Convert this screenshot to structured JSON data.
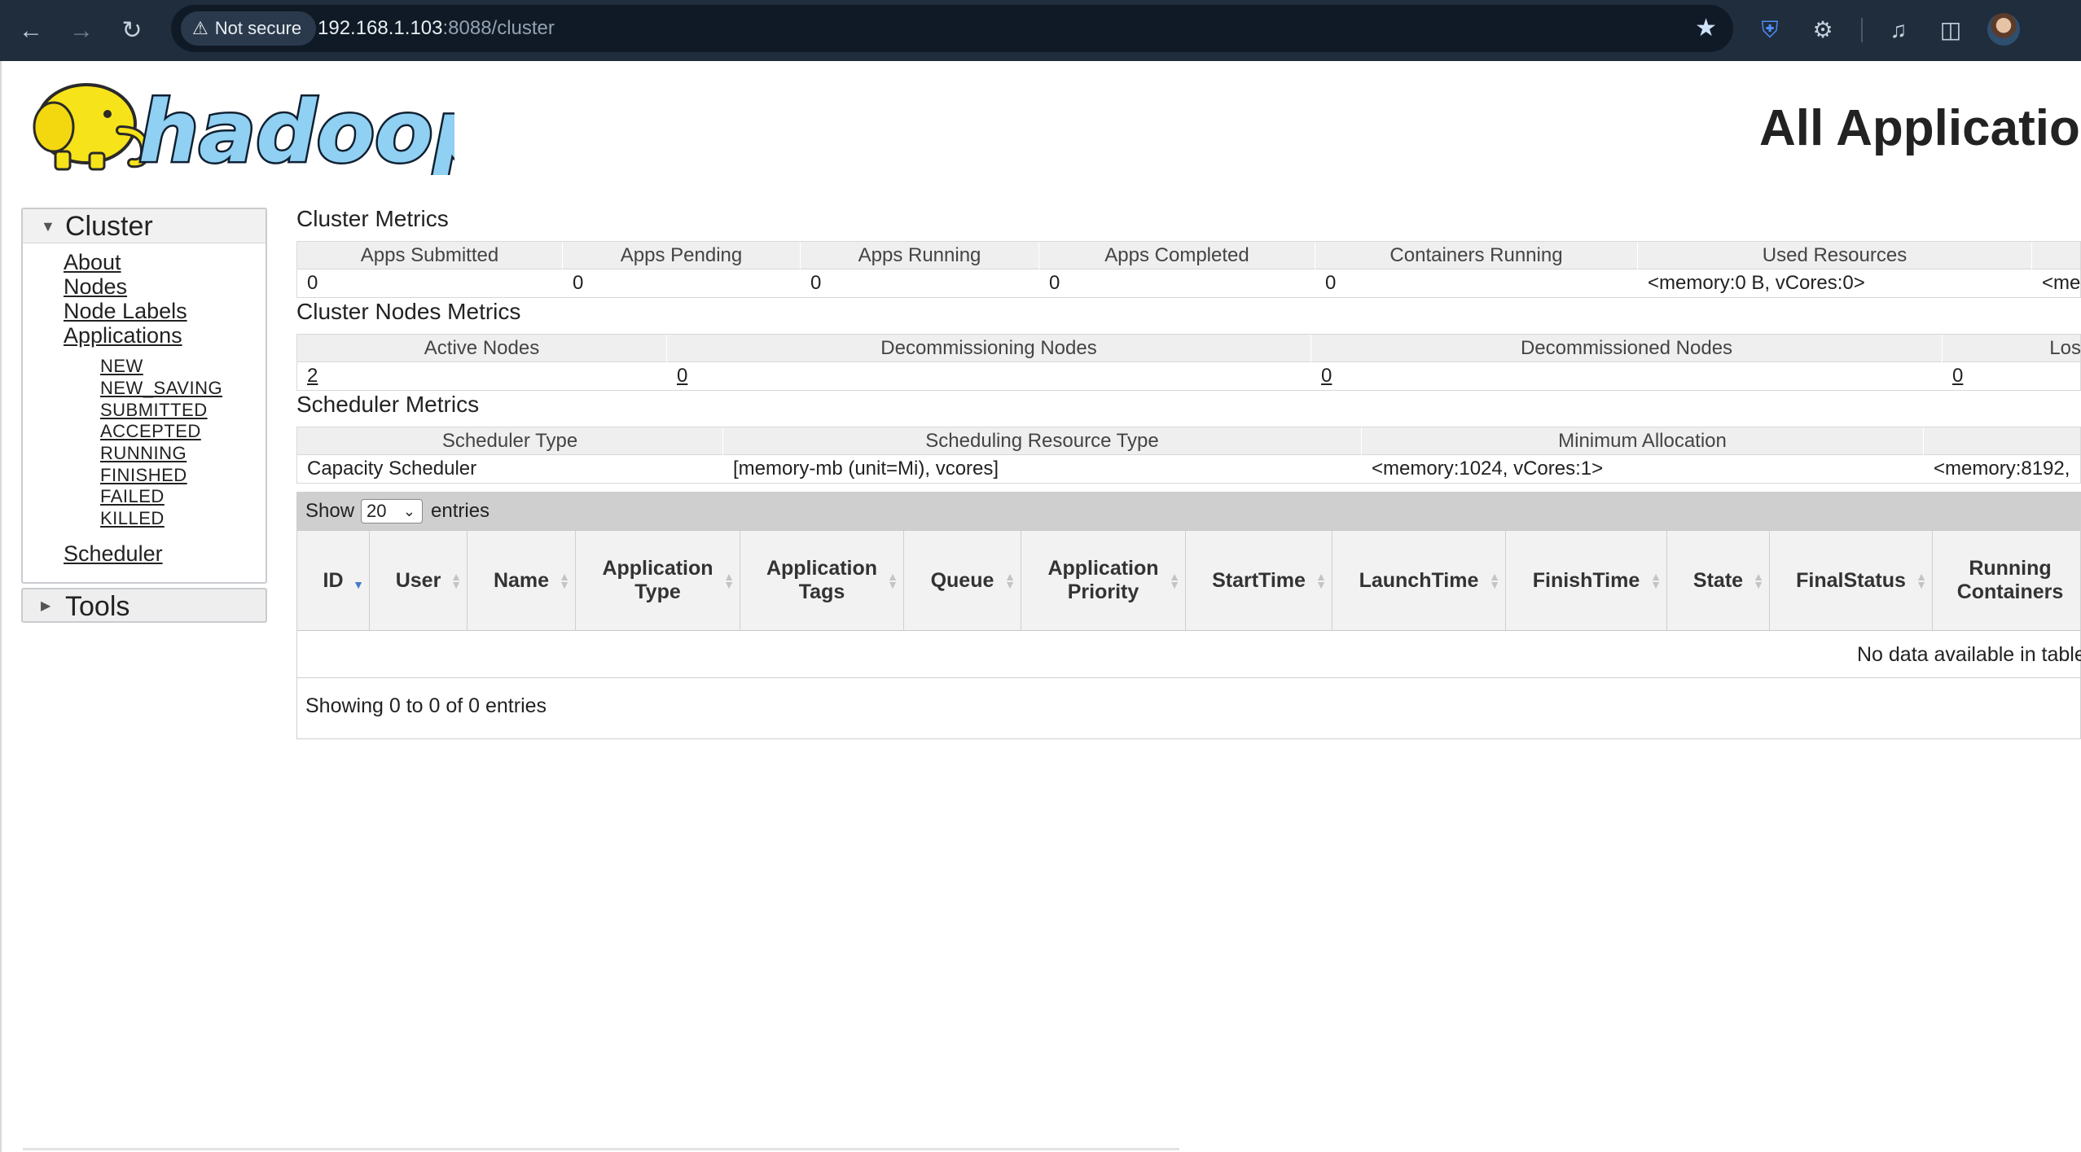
{
  "browser": {
    "security_label": "Not secure",
    "url_host": "192.168.1.103",
    "url_rest": ":8088/cluster"
  },
  "logo_text": "hadoop",
  "page_title": "All Applications",
  "sidebar": {
    "cluster_label": "Cluster",
    "links": [
      "About",
      "Nodes",
      "Node Labels",
      "Applications"
    ],
    "app_states": [
      "NEW",
      "NEW_SAVING",
      "SUBMITTED",
      "ACCEPTED",
      "RUNNING",
      "FINISHED",
      "FAILED",
      "KILLED"
    ],
    "scheduler_link": "Scheduler",
    "tools_label": "Tools"
  },
  "cluster_metrics": {
    "title": "Cluster Metrics",
    "headers": [
      "Apps Submitted",
      "Apps Pending",
      "Apps Running",
      "Apps Completed",
      "Containers Running",
      "Used Resources",
      ""
    ],
    "values": [
      "0",
      "0",
      "0",
      "0",
      "0",
      "<memory:0 B, vCores:0>",
      "<me"
    ]
  },
  "cluster_nodes_metrics": {
    "title": "Cluster Nodes Metrics",
    "headers": [
      "Active Nodes",
      "Decommissioning Nodes",
      "Decommissioned Nodes",
      "Los"
    ],
    "values": [
      "2",
      "0",
      "0",
      "0"
    ]
  },
  "scheduler_metrics": {
    "title": "Scheduler Metrics",
    "headers": [
      "Scheduler Type",
      "Scheduling Resource Type",
      "Minimum Allocation",
      ""
    ],
    "values": [
      "Capacity Scheduler",
      "[memory-mb (unit=Mi), vcores]",
      "<memory:1024, vCores:1>",
      "<memory:8192,"
    ]
  },
  "apps_table": {
    "show_label": "Show",
    "entries_value": "20",
    "entries_label": "entries",
    "columns": [
      "ID",
      "User",
      "Name",
      "Application Type",
      "Application Tags",
      "Queue",
      "Application Priority",
      "StartTime",
      "LaunchTime",
      "FinishTime",
      "State",
      "FinalStatus",
      "Running Containers"
    ],
    "no_data": "No data available in table",
    "info": "Showing 0 to 0 of 0 entries"
  },
  "colors": {
    "chrome": "#1f2d3d",
    "header_cell": "#efefef",
    "toolbar": "#cfcfcf"
  }
}
